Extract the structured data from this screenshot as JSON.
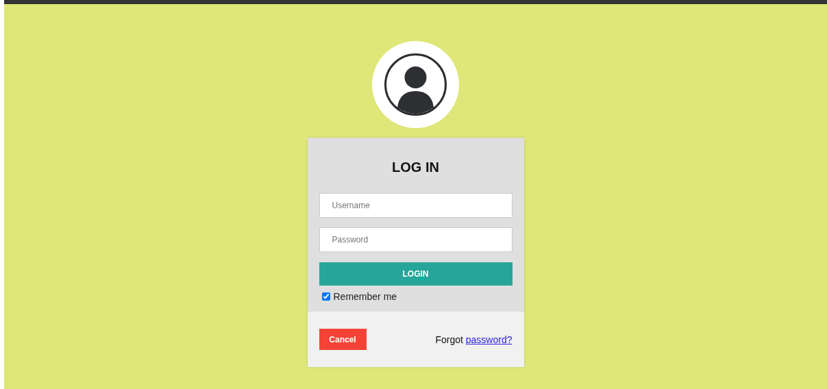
{
  "login": {
    "title": "LOG IN",
    "fields": [
      {
        "placeholder": "Username"
      },
      {
        "placeholder": "Password"
      }
    ],
    "login_button": "LOGIN",
    "remember": {
      "label": "Remember me",
      "checked": true
    },
    "cancel_button": "Cancel",
    "forgot": {
      "text": "Forgot",
      "link": "password?"
    }
  }
}
